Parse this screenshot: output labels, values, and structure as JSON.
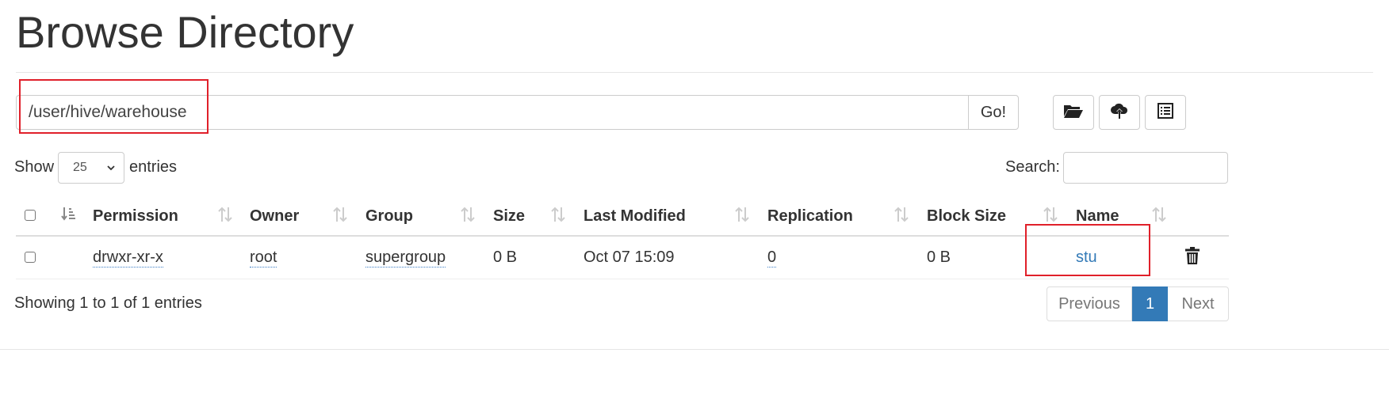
{
  "page_title": "Browse Directory",
  "path_bar": {
    "value": "/user/hive/warehouse",
    "go_label": "Go!"
  },
  "toolbar": {
    "icons": [
      "folder-open-icon",
      "cloud-upload-icon",
      "list-icon"
    ]
  },
  "entries_control": {
    "show_label": "Show",
    "selected": "25",
    "entries_label": "entries"
  },
  "search": {
    "label": "Search:",
    "value": ""
  },
  "table": {
    "columns": [
      "Permission",
      "Owner",
      "Group",
      "Size",
      "Last Modified",
      "Replication",
      "Block Size",
      "Name"
    ],
    "rows": [
      {
        "permission": "drwxr-xr-x",
        "owner": "root",
        "group": "supergroup",
        "size": "0 B",
        "last_modified": "Oct 07 15:09",
        "replication": "0",
        "block_size": "0 B",
        "name": "stu"
      }
    ]
  },
  "info": "Showing 1 to 1 of 1 entries",
  "pagination": {
    "previous": "Previous",
    "current": "1",
    "next": "Next"
  },
  "colors": {
    "accent": "#337ab7",
    "highlight": "#e0202a"
  }
}
